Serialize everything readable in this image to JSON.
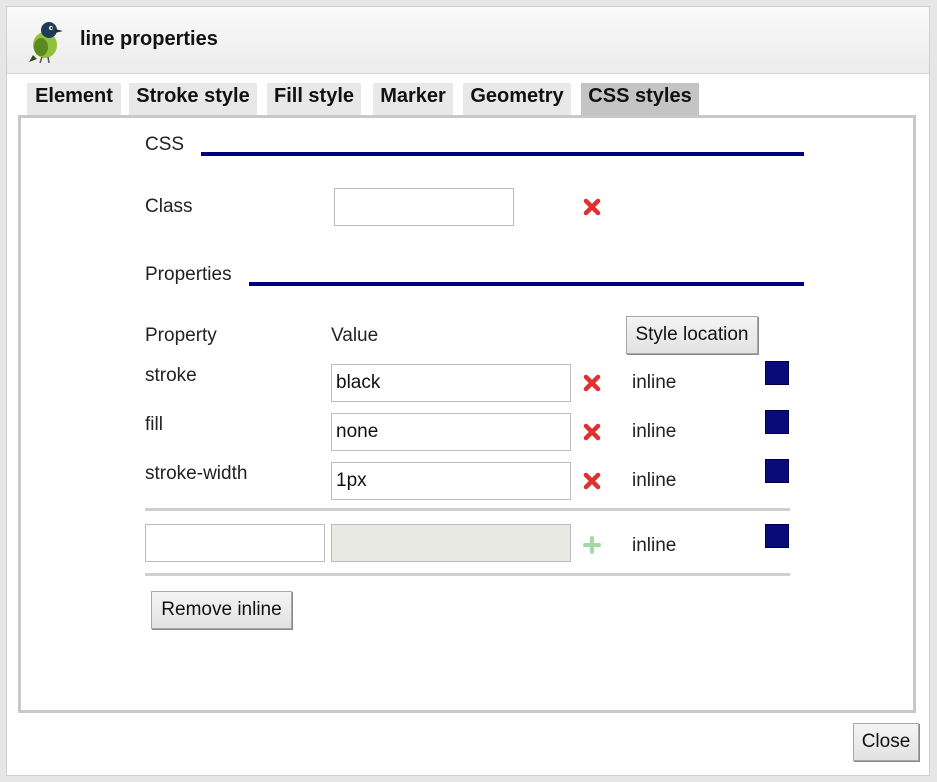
{
  "dialog": {
    "title": "line properties",
    "logo_icon": "bird-logo-icon",
    "close_label": "Close"
  },
  "tabs": [
    {
      "label": "Element",
      "active": false
    },
    {
      "label": "Stroke style",
      "active": false
    },
    {
      "label": "Fill style",
      "active": false
    },
    {
      "label": "Marker",
      "active": false
    },
    {
      "label": "Geometry",
      "active": false
    },
    {
      "label": "CSS styles",
      "active": true
    }
  ],
  "css_section": {
    "heading": "CSS",
    "class_label": "Class",
    "class_value": ""
  },
  "properties_section": {
    "heading": "Properties",
    "col_property": "Property",
    "col_value": "Value",
    "style_location_label": "Style location",
    "rows": [
      {
        "property": "stroke",
        "value": "black",
        "location": "inline"
      },
      {
        "property": "fill",
        "value": "none",
        "location": "inline"
      },
      {
        "property": "stroke-width",
        "value": "1px",
        "location": "inline"
      }
    ],
    "new_row": {
      "property": "",
      "value": "",
      "location": "inline"
    },
    "remove_inline_label": "Remove inline"
  },
  "colors": {
    "accent_rule": "#00007a",
    "swatch": "#0a0a7a",
    "delete_icon": "#e03030",
    "add_icon": "#a8d8a8"
  }
}
